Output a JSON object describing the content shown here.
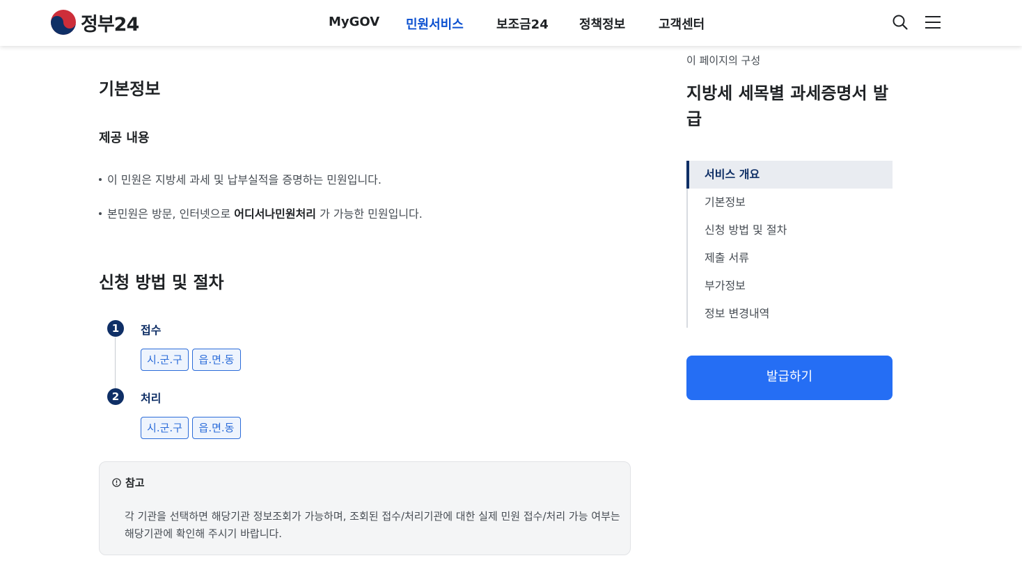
{
  "header": {
    "logo_text": "정부24",
    "nav": [
      {
        "label": "MyGOV",
        "active": false
      },
      {
        "label": "민원서비스",
        "active": true
      },
      {
        "label": "보조금24",
        "active": false
      },
      {
        "label": "정책정보",
        "active": false
      },
      {
        "label": "고객센터",
        "active": false
      }
    ],
    "icons": [
      "search-icon",
      "menu-icon"
    ],
    "accent_color": "#0b50d0"
  },
  "main": {
    "basic_info": {
      "heading": "기본정보",
      "sub_heading": "제공 내용",
      "bullets": [
        {
          "text": "이 민원은 지방세 과세 및 납부실적을 증명하는 민원입니다."
        },
        {
          "prefix": "본민원은 방문, 인터넷으로 ",
          "bold": "어디서나민원처리",
          "suffix": " 가 가능한 민원입니다."
        }
      ]
    },
    "procedure": {
      "heading": "신청 방법 및 절차",
      "steps": [
        {
          "num": "1",
          "title": "접수",
          "tags": [
            "시.군.구",
            "읍.면.동"
          ]
        },
        {
          "num": "2",
          "title": "처리",
          "tags": [
            "시.군.구",
            "읍.면.동"
          ]
        }
      ]
    },
    "note": {
      "title": "참고",
      "body": "각 기관을 선택하면 해당기관 정보조회가 가능하며, 조회된 접수/처리기관에 대한 실제 민원 접수/처리 가능 여부는 해당기관에 확인해 주시기 바랍니다."
    }
  },
  "toc": {
    "caption": "이 페이지의 구성",
    "title": "지방세 세목별 과세증명서 발급",
    "items": [
      {
        "label": "서비스 개요",
        "active": true
      },
      {
        "label": "기본정보",
        "active": false
      },
      {
        "label": "신청 방법 및 절차",
        "active": false
      },
      {
        "label": "제출 서류",
        "active": false
      },
      {
        "label": "부가정보",
        "active": false
      },
      {
        "label": "정보 변경내역",
        "active": false
      }
    ],
    "issue_button": "발급하기",
    "button_color": "#256ef4"
  }
}
